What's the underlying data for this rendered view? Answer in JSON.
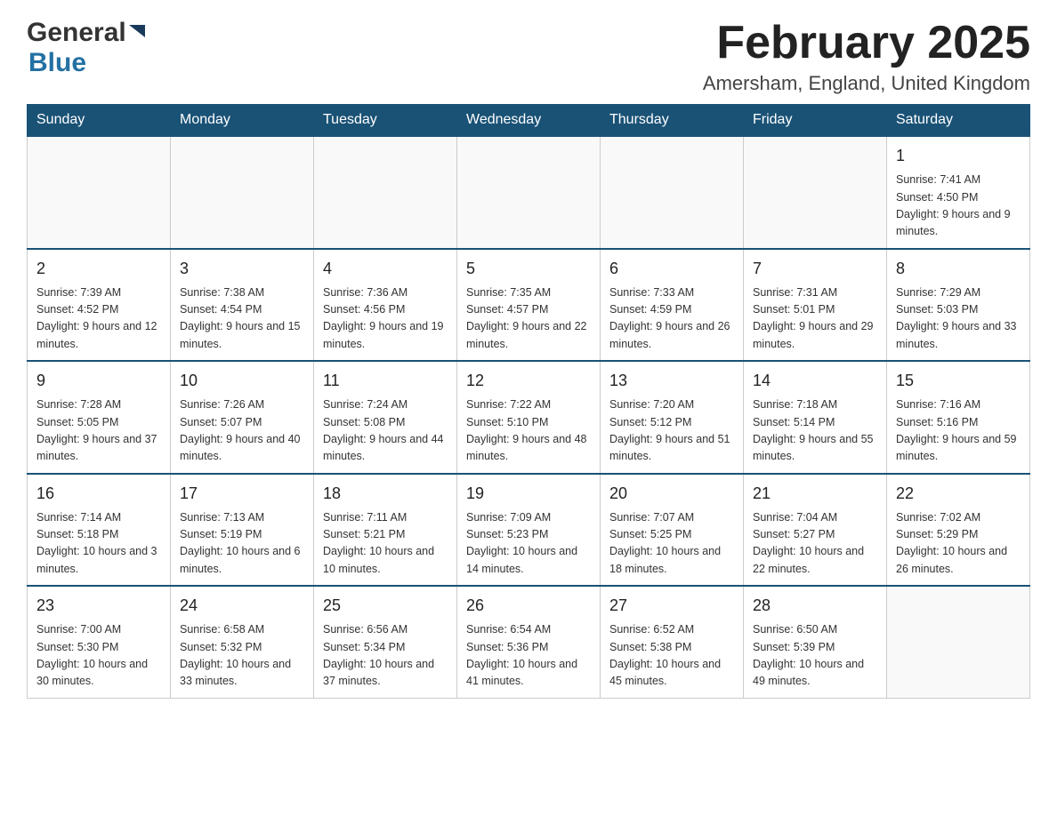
{
  "header": {
    "logo": {
      "general": "General",
      "blue": "Blue",
      "arrow": "▶"
    },
    "title": "February 2025",
    "subtitle": "Amersham, England, United Kingdom"
  },
  "weekdays": [
    "Sunday",
    "Monday",
    "Tuesday",
    "Wednesday",
    "Thursday",
    "Friday",
    "Saturday"
  ],
  "weeks": [
    {
      "days": [
        {
          "num": "",
          "info": ""
        },
        {
          "num": "",
          "info": ""
        },
        {
          "num": "",
          "info": ""
        },
        {
          "num": "",
          "info": ""
        },
        {
          "num": "",
          "info": ""
        },
        {
          "num": "",
          "info": ""
        },
        {
          "num": "1",
          "info": "Sunrise: 7:41 AM\nSunset: 4:50 PM\nDaylight: 9 hours and 9 minutes."
        }
      ]
    },
    {
      "days": [
        {
          "num": "2",
          "info": "Sunrise: 7:39 AM\nSunset: 4:52 PM\nDaylight: 9 hours and 12 minutes."
        },
        {
          "num": "3",
          "info": "Sunrise: 7:38 AM\nSunset: 4:54 PM\nDaylight: 9 hours and 15 minutes."
        },
        {
          "num": "4",
          "info": "Sunrise: 7:36 AM\nSunset: 4:56 PM\nDaylight: 9 hours and 19 minutes."
        },
        {
          "num": "5",
          "info": "Sunrise: 7:35 AM\nSunset: 4:57 PM\nDaylight: 9 hours and 22 minutes."
        },
        {
          "num": "6",
          "info": "Sunrise: 7:33 AM\nSunset: 4:59 PM\nDaylight: 9 hours and 26 minutes."
        },
        {
          "num": "7",
          "info": "Sunrise: 7:31 AM\nSunset: 5:01 PM\nDaylight: 9 hours and 29 minutes."
        },
        {
          "num": "8",
          "info": "Sunrise: 7:29 AM\nSunset: 5:03 PM\nDaylight: 9 hours and 33 minutes."
        }
      ]
    },
    {
      "days": [
        {
          "num": "9",
          "info": "Sunrise: 7:28 AM\nSunset: 5:05 PM\nDaylight: 9 hours and 37 minutes."
        },
        {
          "num": "10",
          "info": "Sunrise: 7:26 AM\nSunset: 5:07 PM\nDaylight: 9 hours and 40 minutes."
        },
        {
          "num": "11",
          "info": "Sunrise: 7:24 AM\nSunset: 5:08 PM\nDaylight: 9 hours and 44 minutes."
        },
        {
          "num": "12",
          "info": "Sunrise: 7:22 AM\nSunset: 5:10 PM\nDaylight: 9 hours and 48 minutes."
        },
        {
          "num": "13",
          "info": "Sunrise: 7:20 AM\nSunset: 5:12 PM\nDaylight: 9 hours and 51 minutes."
        },
        {
          "num": "14",
          "info": "Sunrise: 7:18 AM\nSunset: 5:14 PM\nDaylight: 9 hours and 55 minutes."
        },
        {
          "num": "15",
          "info": "Sunrise: 7:16 AM\nSunset: 5:16 PM\nDaylight: 9 hours and 59 minutes."
        }
      ]
    },
    {
      "days": [
        {
          "num": "16",
          "info": "Sunrise: 7:14 AM\nSunset: 5:18 PM\nDaylight: 10 hours and 3 minutes."
        },
        {
          "num": "17",
          "info": "Sunrise: 7:13 AM\nSunset: 5:19 PM\nDaylight: 10 hours and 6 minutes."
        },
        {
          "num": "18",
          "info": "Sunrise: 7:11 AM\nSunset: 5:21 PM\nDaylight: 10 hours and 10 minutes."
        },
        {
          "num": "19",
          "info": "Sunrise: 7:09 AM\nSunset: 5:23 PM\nDaylight: 10 hours and 14 minutes."
        },
        {
          "num": "20",
          "info": "Sunrise: 7:07 AM\nSunset: 5:25 PM\nDaylight: 10 hours and 18 minutes."
        },
        {
          "num": "21",
          "info": "Sunrise: 7:04 AM\nSunset: 5:27 PM\nDaylight: 10 hours and 22 minutes."
        },
        {
          "num": "22",
          "info": "Sunrise: 7:02 AM\nSunset: 5:29 PM\nDaylight: 10 hours and 26 minutes."
        }
      ]
    },
    {
      "days": [
        {
          "num": "23",
          "info": "Sunrise: 7:00 AM\nSunset: 5:30 PM\nDaylight: 10 hours and 30 minutes."
        },
        {
          "num": "24",
          "info": "Sunrise: 6:58 AM\nSunset: 5:32 PM\nDaylight: 10 hours and 33 minutes."
        },
        {
          "num": "25",
          "info": "Sunrise: 6:56 AM\nSunset: 5:34 PM\nDaylight: 10 hours and 37 minutes."
        },
        {
          "num": "26",
          "info": "Sunrise: 6:54 AM\nSunset: 5:36 PM\nDaylight: 10 hours and 41 minutes."
        },
        {
          "num": "27",
          "info": "Sunrise: 6:52 AM\nSunset: 5:38 PM\nDaylight: 10 hours and 45 minutes."
        },
        {
          "num": "28",
          "info": "Sunrise: 6:50 AM\nSunset: 5:39 PM\nDaylight: 10 hours and 49 minutes."
        },
        {
          "num": "",
          "info": ""
        }
      ]
    }
  ]
}
